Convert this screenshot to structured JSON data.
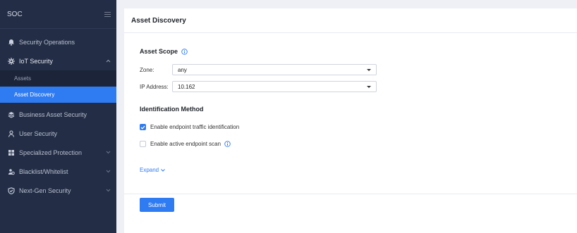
{
  "sidebar": {
    "title": "SOC",
    "items": [
      {
        "label": "Security Operations",
        "icon": "bell-icon"
      },
      {
        "label": "IoT Security",
        "icon": "iot-icon",
        "expanded": true,
        "children": [
          {
            "label": "Assets"
          },
          {
            "label": "Asset Discovery",
            "active": true
          }
        ]
      },
      {
        "label": "Business Asset Security",
        "icon": "layers-icon"
      },
      {
        "label": "User Security",
        "icon": "user-icon"
      },
      {
        "label": "Specialized Protection",
        "icon": "grid-icon"
      },
      {
        "label": "Blacklist/Whitelist",
        "icon": "users-icon"
      },
      {
        "label": "Next-Gen Security",
        "icon": "shield-icon"
      }
    ]
  },
  "page": {
    "title": "Asset Discovery"
  },
  "scope": {
    "title": "Asset Scope",
    "zone_label": "Zone:",
    "zone_value": "any",
    "ip_label": "IP Address:",
    "ip_value": "10.162"
  },
  "identification": {
    "title": "Identification Method",
    "traffic_label": "Enable endpoint traffic identification",
    "traffic_checked": true,
    "scan_label": "Enable active endpoint scan",
    "scan_checked": false
  },
  "expand_label": "Expand",
  "submit_label": "Submit",
  "colors": {
    "accent": "#2f7bf2",
    "sidebar_bg": "#232d45"
  }
}
